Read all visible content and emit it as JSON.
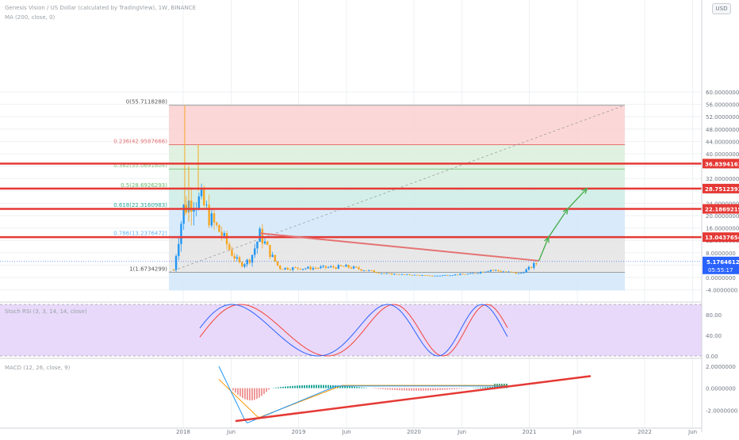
{
  "header": {
    "title": "Genesis Vision / US Dollar (calculated by TradingView), 1W, BINANCE",
    "ma_label": "MA (200, close, 0)",
    "currency_button": "USD"
  },
  "colors": {
    "candle_up": "#2196f3",
    "candle_down": "#f5a623",
    "resistance_line": "#e53935",
    "trend_line": "#e57373",
    "arrow": "#4caf50",
    "stoch_k": "#2962ff",
    "stoch_d": "#f44336",
    "macd_line": "#2196f3",
    "signal_line": "#ff9800",
    "price_badge": "#2962ff",
    "level_badge": "#e53935"
  },
  "price_axis": {
    "ticks": [
      "60.0000000",
      "56.0000000",
      "52.0000000",
      "48.0000000",
      "44.0000000",
      "40.0000000",
      "36.0000000",
      "32.0000000",
      "28.0000000",
      "24.0000000",
      "20.0000000",
      "16.0000000",
      "12.0000000",
      "8.0000000",
      "4.0000000",
      "0.0000000",
      "-4.0000000"
    ],
    "current_price": "5.1764612",
    "countdown": "05:55:17"
  },
  "fib_levels": [
    {
      "label": "0(55.7118288)",
      "ratio": "0",
      "value": 55.7118288
    },
    {
      "label": "0.236(42.9587666)",
      "ratio": "0.236",
      "value": 42.9587666
    },
    {
      "label": "0.382(35.0691604)",
      "ratio": "0.382",
      "value": 35.0691604
    },
    {
      "label": "0.5(28.6926293)",
      "ratio": "0.5",
      "value": 28.6926293
    },
    {
      "label": "0.618(22.3160983)",
      "ratio": "0.618",
      "value": 22.3160983
    },
    {
      "label": "0.786(13.2376472)",
      "ratio": "0.786",
      "value": 13.2376472
    },
    {
      "label": "1(1.6734299)",
      "ratio": "1",
      "value": 1.6734299
    }
  ],
  "resistance_levels": [
    {
      "label": "36.8394161",
      "value": 36.8394161
    },
    {
      "label": "28.7512393",
      "value": 28.7512393
    },
    {
      "label": "22.1869219",
      "value": 22.1869219
    },
    {
      "label": "13.0437654",
      "value": 13.0437654
    }
  ],
  "stoch": {
    "label": "Stoch RSI (3, 3, 14, 14, close)",
    "ticks": [
      "80.00",
      "40.00",
      "0.00"
    ]
  },
  "macd": {
    "label": "MACD (12, 26, close, 9)",
    "ticks": [
      "2.0000000",
      "0.0000000",
      "-2.0000000"
    ]
  },
  "time_axis": {
    "labels": [
      "2018",
      "Jun",
      "2019",
      "Jun",
      "2020",
      "Jun",
      "2021",
      "Jun",
      "2022",
      "Jun"
    ]
  },
  "chart_data": {
    "type": "candlestick",
    "symbol": "Genesis Vision / US Dollar",
    "interval": "1W",
    "exchange": "BINANCE",
    "ylim": [
      -4,
      60
    ],
    "close_series_approx": [
      {
        "x": "2017-12",
        "y": 2.5
      },
      {
        "x": "2018-01",
        "y": 22
      },
      {
        "x": "2018-02",
        "y": 26
      },
      {
        "x": "2018-03",
        "y": 24
      },
      {
        "x": "2018-04",
        "y": 18
      },
      {
        "x": "2018-05",
        "y": 14
      },
      {
        "x": "2018-06",
        "y": 8
      },
      {
        "x": "2018-07",
        "y": 4
      },
      {
        "x": "2018-08",
        "y": 6
      },
      {
        "x": "2018-09",
        "y": 14
      },
      {
        "x": "2018-10",
        "y": 8
      },
      {
        "x": "2018-11",
        "y": 3
      },
      {
        "x": "2019-02",
        "y": 3
      },
      {
        "x": "2019-06",
        "y": 3.5
      },
      {
        "x": "2019-10",
        "y": 1.2
      },
      {
        "x": "2020-03",
        "y": 0.5
      },
      {
        "x": "2020-07",
        "y": 1.2
      },
      {
        "x": "2020-09",
        "y": 2.5
      },
      {
        "x": "2020-12",
        "y": 1.2
      },
      {
        "x": "2021-01",
        "y": 3
      },
      {
        "x": "2021-02",
        "y": 5.18
      }
    ],
    "stoch_rsi": {
      "ylim": [
        0,
        100
      ]
    },
    "macd": {
      "ylim": [
        -3.5,
        2.5
      ]
    }
  }
}
